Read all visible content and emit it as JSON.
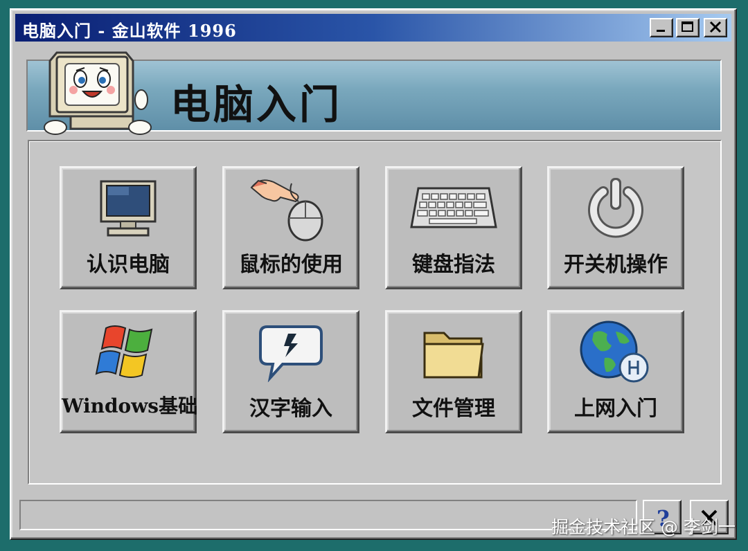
{
  "window": {
    "title": "电脑入门 - 金山软件 1996",
    "controls": {
      "minimize": "minimize",
      "maximize": "maximize",
      "close": "close"
    }
  },
  "banner": {
    "title": "电脑入门",
    "mascot_icon": "computer-mascot-icon"
  },
  "tiles": [
    {
      "label": "认识电脑",
      "icon": "monitor-icon"
    },
    {
      "label": "鼠标的使用",
      "icon": "hand-mouse-icon"
    },
    {
      "label": "键盘指法",
      "icon": "keyboard-icon"
    },
    {
      "label": "开关机操作",
      "icon": "power-icon"
    },
    {
      "label": "Windows基础",
      "icon": "windows-logo-icon"
    },
    {
      "label": "汉字输入",
      "icon": "chat-bubble-icon"
    },
    {
      "label": "文件管理",
      "icon": "folder-icon"
    },
    {
      "label": "上网入门",
      "icon": "globe-icon"
    }
  ],
  "footer": {
    "help_icon": "help-icon",
    "close_icon": "close-icon"
  },
  "watermark": "掘金技术社区 @ 李剑一",
  "colors": {
    "desktop": "#1d6d6b",
    "title_start": "#0a1f73",
    "title_end": "#a6caf0",
    "face": "#c3c3c3"
  }
}
